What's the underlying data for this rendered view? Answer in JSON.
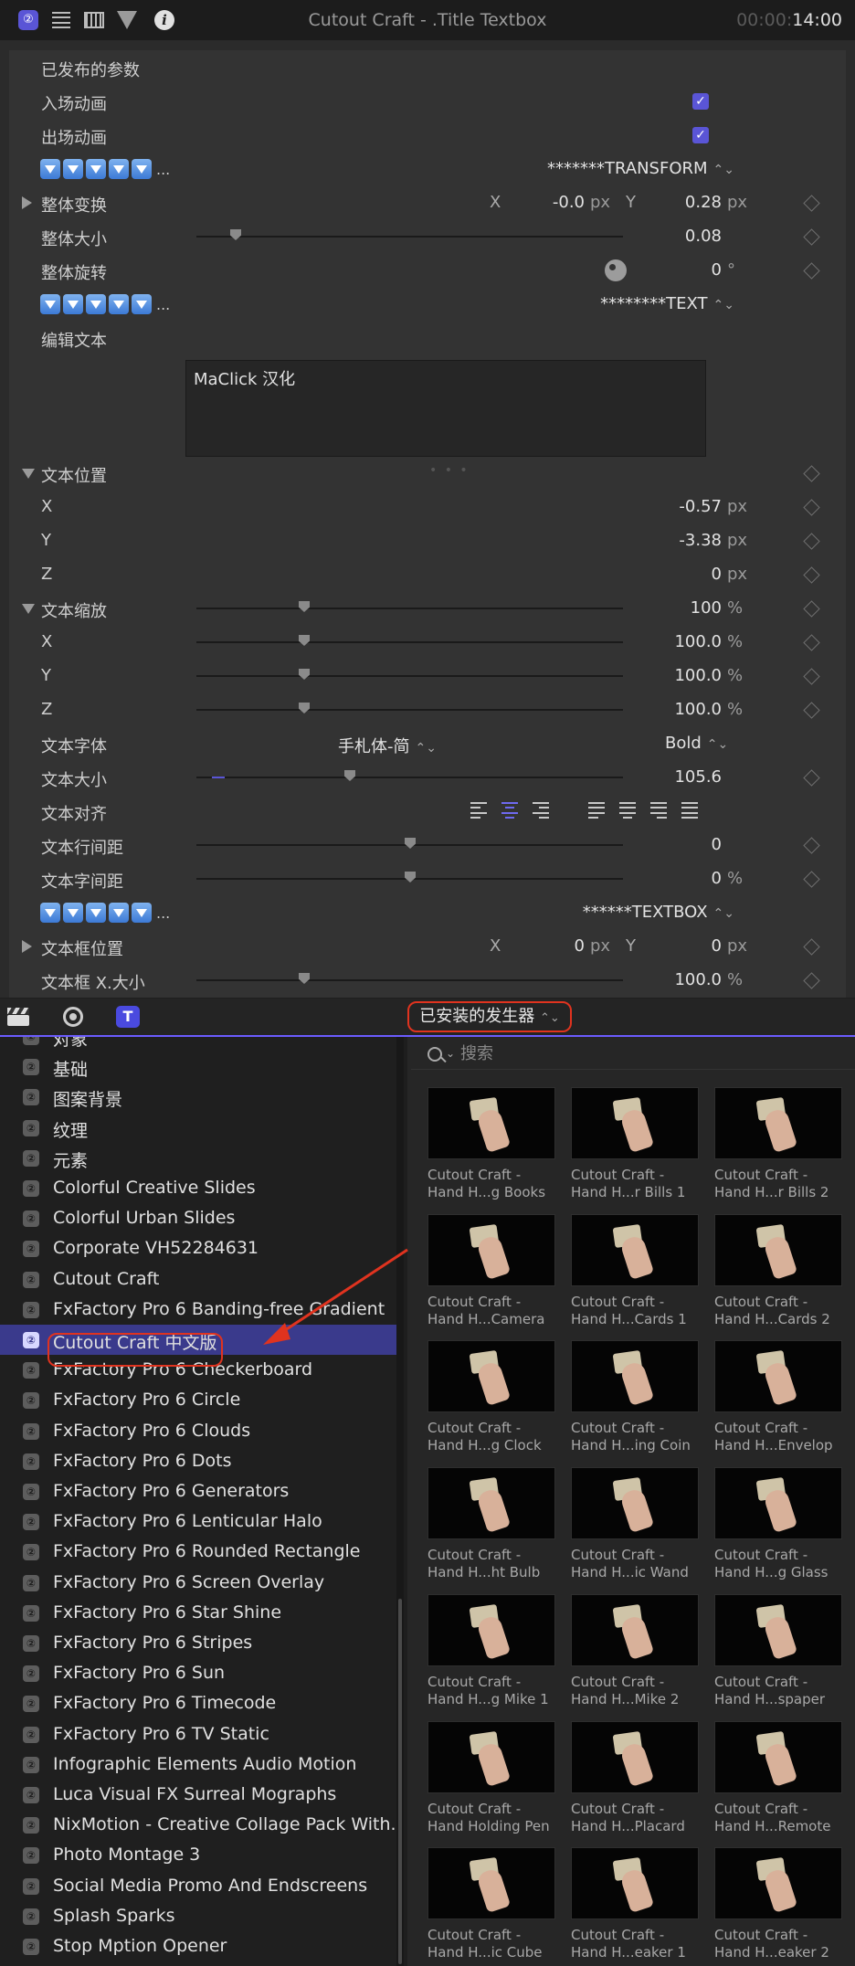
{
  "titlebar": {
    "title": "Cutout Craft - .Title Textbox",
    "timecode_dim": "00:00:",
    "timecode_bright": "14:00",
    "icons": [
      "generator-badge-icon",
      "list-icon",
      "film-icon",
      "filter-icon",
      "info-icon"
    ]
  },
  "inspector": {
    "section_title": "已发布的参数",
    "build_in": "入场动画",
    "build_out": "出场动画",
    "transform_popup": "*******TRANSFORM",
    "overall_transform": "整体变换",
    "overall_transform_x": "-0.0",
    "overall_transform_y": "0.28",
    "overall_size": "整体大小",
    "overall_size_value": "0.08",
    "overall_rotation": "整体旋转",
    "overall_rotation_value": "0",
    "text_popup": "********TEXT",
    "edit_text": "编辑文本",
    "edit_text_value": "MaClick 汉化",
    "text_position": "文本位置",
    "text_position_x": "-0.57",
    "text_position_y": "-3.38",
    "text_position_z": "0",
    "text_scale": "文本缩放",
    "text_scale_value": "100",
    "text_scale_x": "100.0",
    "text_scale_y": "100.0",
    "text_scale_z": "100.0",
    "text_font": "文本字体",
    "text_font_family": "手札体-简",
    "text_font_weight": "Bold",
    "text_size": "文本大小",
    "text_size_value": "105.6",
    "text_align": "文本对齐",
    "line_spacing": "文本行间距",
    "line_spacing_value": "0",
    "char_spacing": "文本字间距",
    "char_spacing_value": "0",
    "textbox_popup": "******TEXTBOX",
    "textbox_position": "文本框位置",
    "textbox_position_x": "0",
    "textbox_position_y": "0",
    "textbox_size": "文本框 X.大小",
    "textbox_size_value": "100.0",
    "unit_px": "px",
    "unit_pct": "%",
    "unit_deg": "°",
    "axis_x": "X",
    "axis_y": "Y",
    "axis_z": "Z",
    "ellipsis": "..."
  },
  "browser": {
    "dropdown": "已安装的发生器",
    "search_placeholder": "搜索"
  },
  "sidebar": {
    "items": [
      "对象",
      "基础",
      "图案背景",
      "纹理",
      "元素",
      "Colorful Creative Slides",
      "Colorful Urban Slides",
      "Corporate VH52284631",
      "Cutout Craft",
      "FxFactory Pro 6 Banding-free Gradient",
      "Cutout Craft 中文版",
      "FxFactory Pro 6 Checkerboard",
      "FxFactory Pro 6 Circle",
      "FxFactory Pro 6 Clouds",
      "FxFactory Pro 6 Dots",
      "FxFactory Pro 6 Generators",
      "FxFactory Pro 6 Lenticular Halo",
      "FxFactory Pro 6 Rounded Rectangle",
      "FxFactory Pro 6 Screen Overlay",
      "FxFactory Pro 6 Star Shine",
      "FxFactory Pro 6 Stripes",
      "FxFactory Pro 6 Sun",
      "FxFactory Pro 6 Timecode",
      "FxFactory Pro 6 TV Static",
      "Infographic Elements Audio Motion",
      "Luca Visual FX Surreal Mographs",
      "NixMotion - Creative Collage Pack With...",
      "Photo Montage 3",
      "Social Media Promo And Endscreens",
      "Splash Sparks",
      "Stop Mption Opener"
    ],
    "selected_index": 10
  },
  "grid": {
    "tiles": [
      {
        "l1": "Cutout Craft -",
        "l2": "Hand H...g Books"
      },
      {
        "l1": "Cutout Craft -",
        "l2": "Hand H...r Bills 1"
      },
      {
        "l1": "Cutout Craft -",
        "l2": "Hand H...r Bills 2"
      },
      {
        "l1": "Cutout Craft -",
        "l2": "Hand H...Camera"
      },
      {
        "l1": "Cutout Craft -",
        "l2": "Hand H...Cards 1"
      },
      {
        "l1": "Cutout Craft -",
        "l2": "Hand H...Cards 2"
      },
      {
        "l1": "Cutout Craft -",
        "l2": "Hand H...g Clock"
      },
      {
        "l1": "Cutout Craft -",
        "l2": "Hand H...ing Coin"
      },
      {
        "l1": "Cutout Craft -",
        "l2": "Hand H...Envelop"
      },
      {
        "l1": "Cutout Craft -",
        "l2": "Hand H...ht Bulb"
      },
      {
        "l1": "Cutout Craft -",
        "l2": "Hand H...ic Wand"
      },
      {
        "l1": "Cutout Craft -",
        "l2": "Hand H...g Glass"
      },
      {
        "l1": "Cutout Craft -",
        "l2": "Hand H...g Mike 1"
      },
      {
        "l1": "Cutout Craft -",
        "l2": "Hand H...Mike 2"
      },
      {
        "l1": "Cutout Craft -",
        "l2": "Hand H...spaper"
      },
      {
        "l1": "Cutout Craft -",
        "l2": "Hand Holding Pen"
      },
      {
        "l1": "Cutout Craft -",
        "l2": "Hand H...Placard"
      },
      {
        "l1": "Cutout Craft -",
        "l2": "Hand H...Remote"
      },
      {
        "l1": "Cutout Craft -",
        "l2": "Hand H...ic Cube"
      },
      {
        "l1": "Cutout Craft -",
        "l2": "Hand H...eaker 1"
      },
      {
        "l1": "Cutout Craft -",
        "l2": "Hand H...eaker 2"
      }
    ]
  },
  "colors": {
    "accent": "#5a55d6",
    "selection": "#3a3a8c",
    "annotation_red": "#e0331f"
  }
}
